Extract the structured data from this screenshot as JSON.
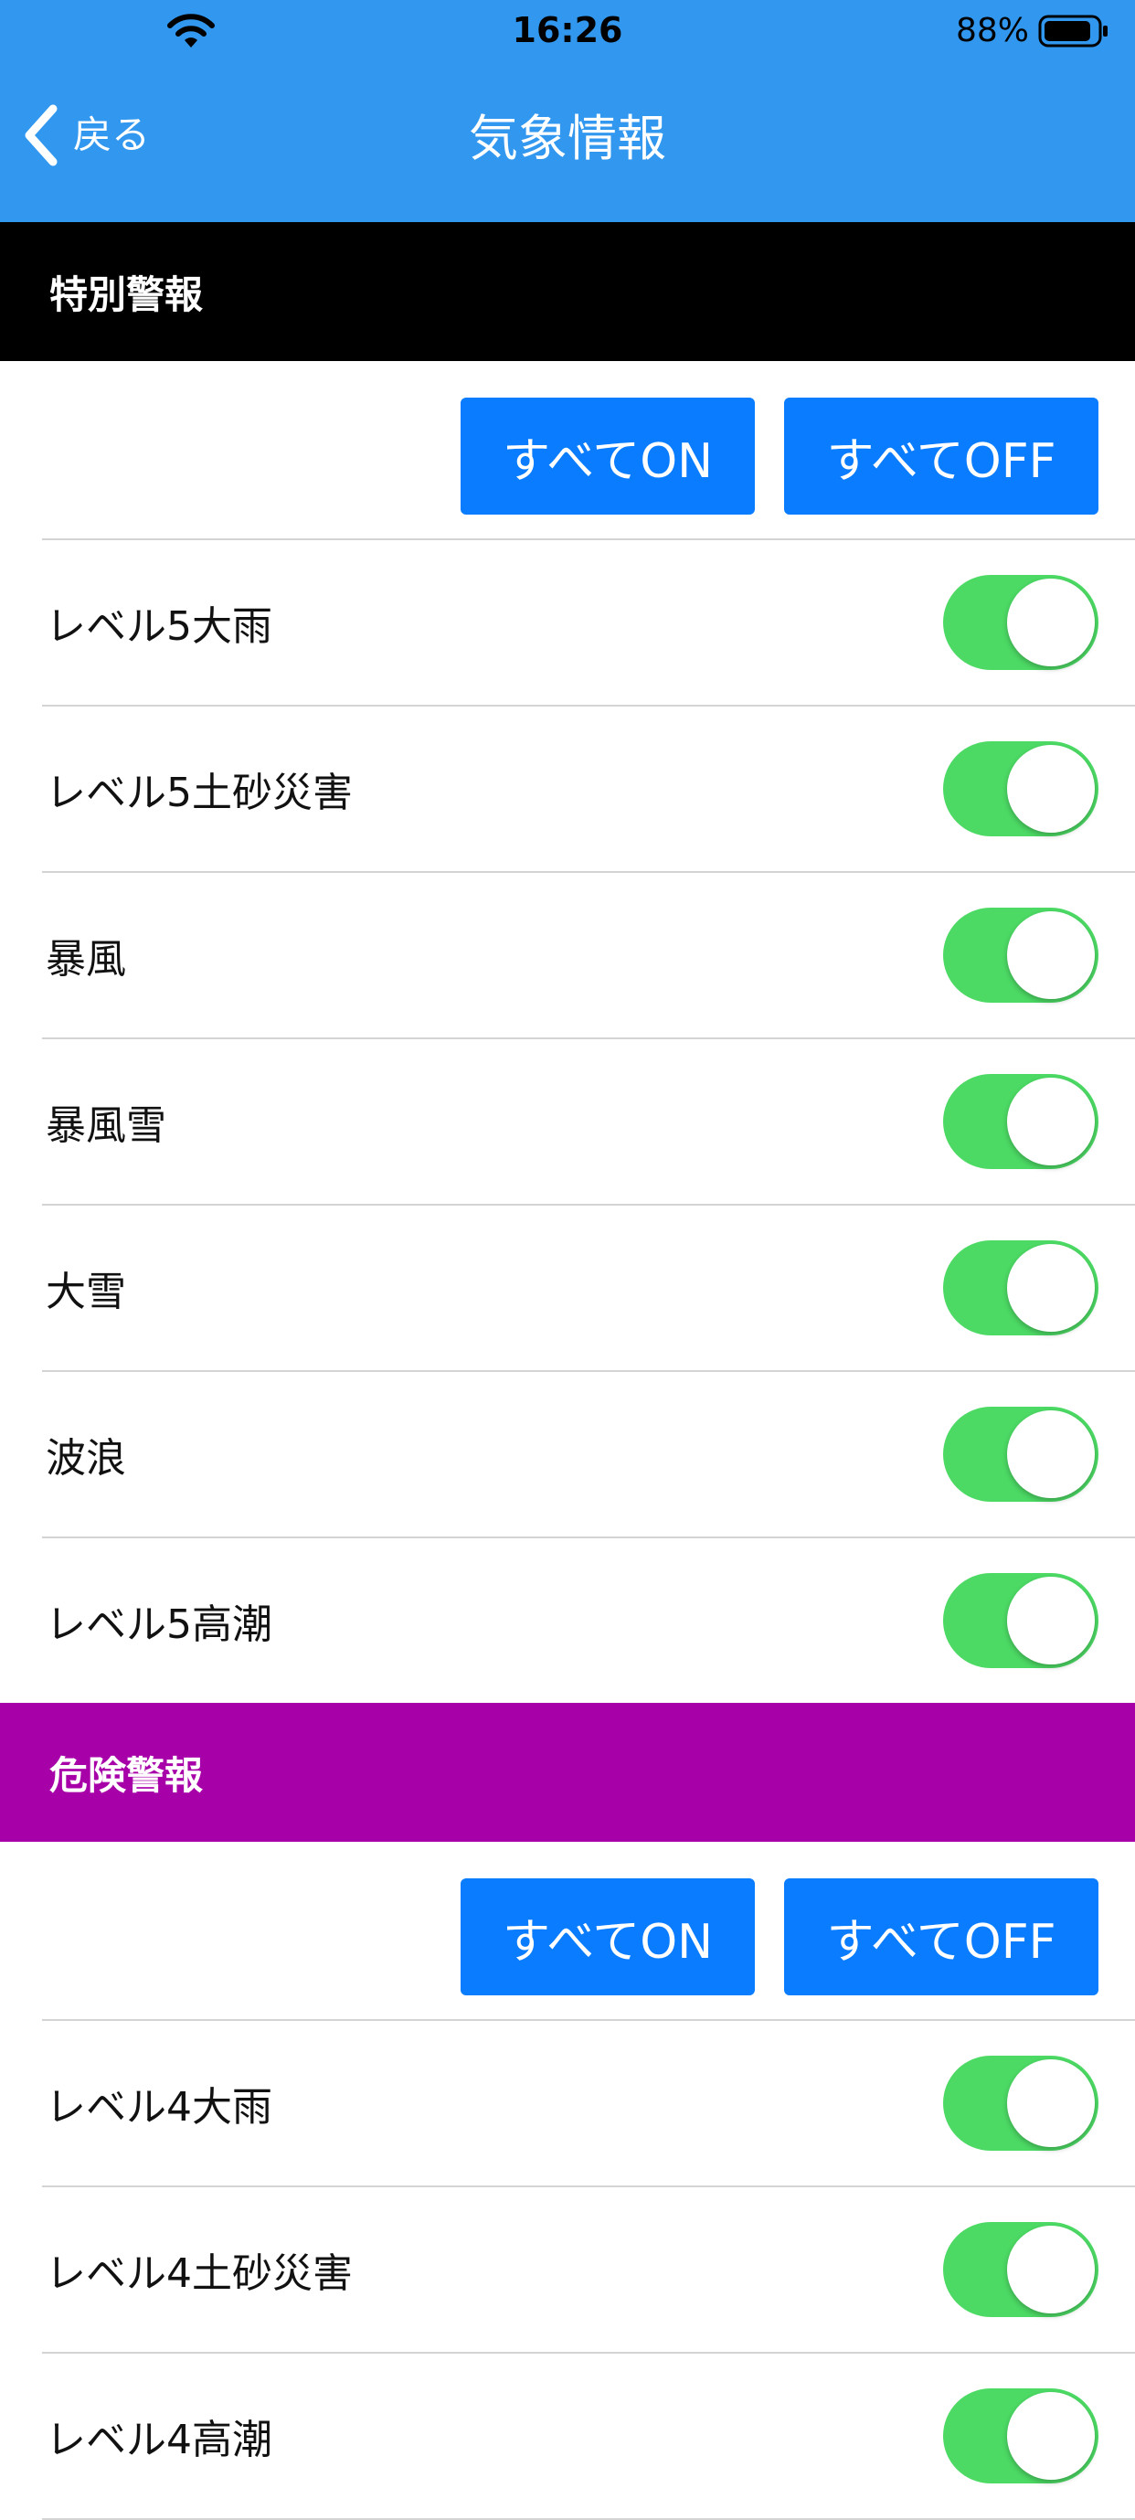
{
  "status_bar": {
    "time": "16:26",
    "battery": "88%",
    "wifi_icon": "wifi-icon",
    "battery_icon": "battery-icon"
  },
  "nav": {
    "back_label": "戻る",
    "back_icon": "chevron-left-icon",
    "title": "気象情報"
  },
  "colors": {
    "nav_bar": "#3197ef",
    "special_header": "#000000",
    "danger_header": "#a800a8",
    "button": "#0a7cff",
    "toggle_on": "#4cd964"
  },
  "sections": [
    {
      "title": "特別警報",
      "all_on_label": "すべてON",
      "all_off_label": "すべてOFF",
      "items": [
        {
          "label": "レベル5大雨",
          "enabled": true
        },
        {
          "label": "レベル5土砂災害",
          "enabled": true
        },
        {
          "label": "暴風",
          "enabled": true
        },
        {
          "label": "暴風雪",
          "enabled": true
        },
        {
          "label": "大雪",
          "enabled": true
        },
        {
          "label": "波浪",
          "enabled": true
        },
        {
          "label": "レベル5高潮",
          "enabled": true
        }
      ]
    },
    {
      "title": "危険警報",
      "all_on_label": "すべてON",
      "all_off_label": "すべてOFF",
      "items": [
        {
          "label": "レベル4大雨",
          "enabled": true
        },
        {
          "label": "レベル4土砂災害",
          "enabled": true
        },
        {
          "label": "レベル4高潮",
          "enabled": true
        }
      ]
    }
  ]
}
